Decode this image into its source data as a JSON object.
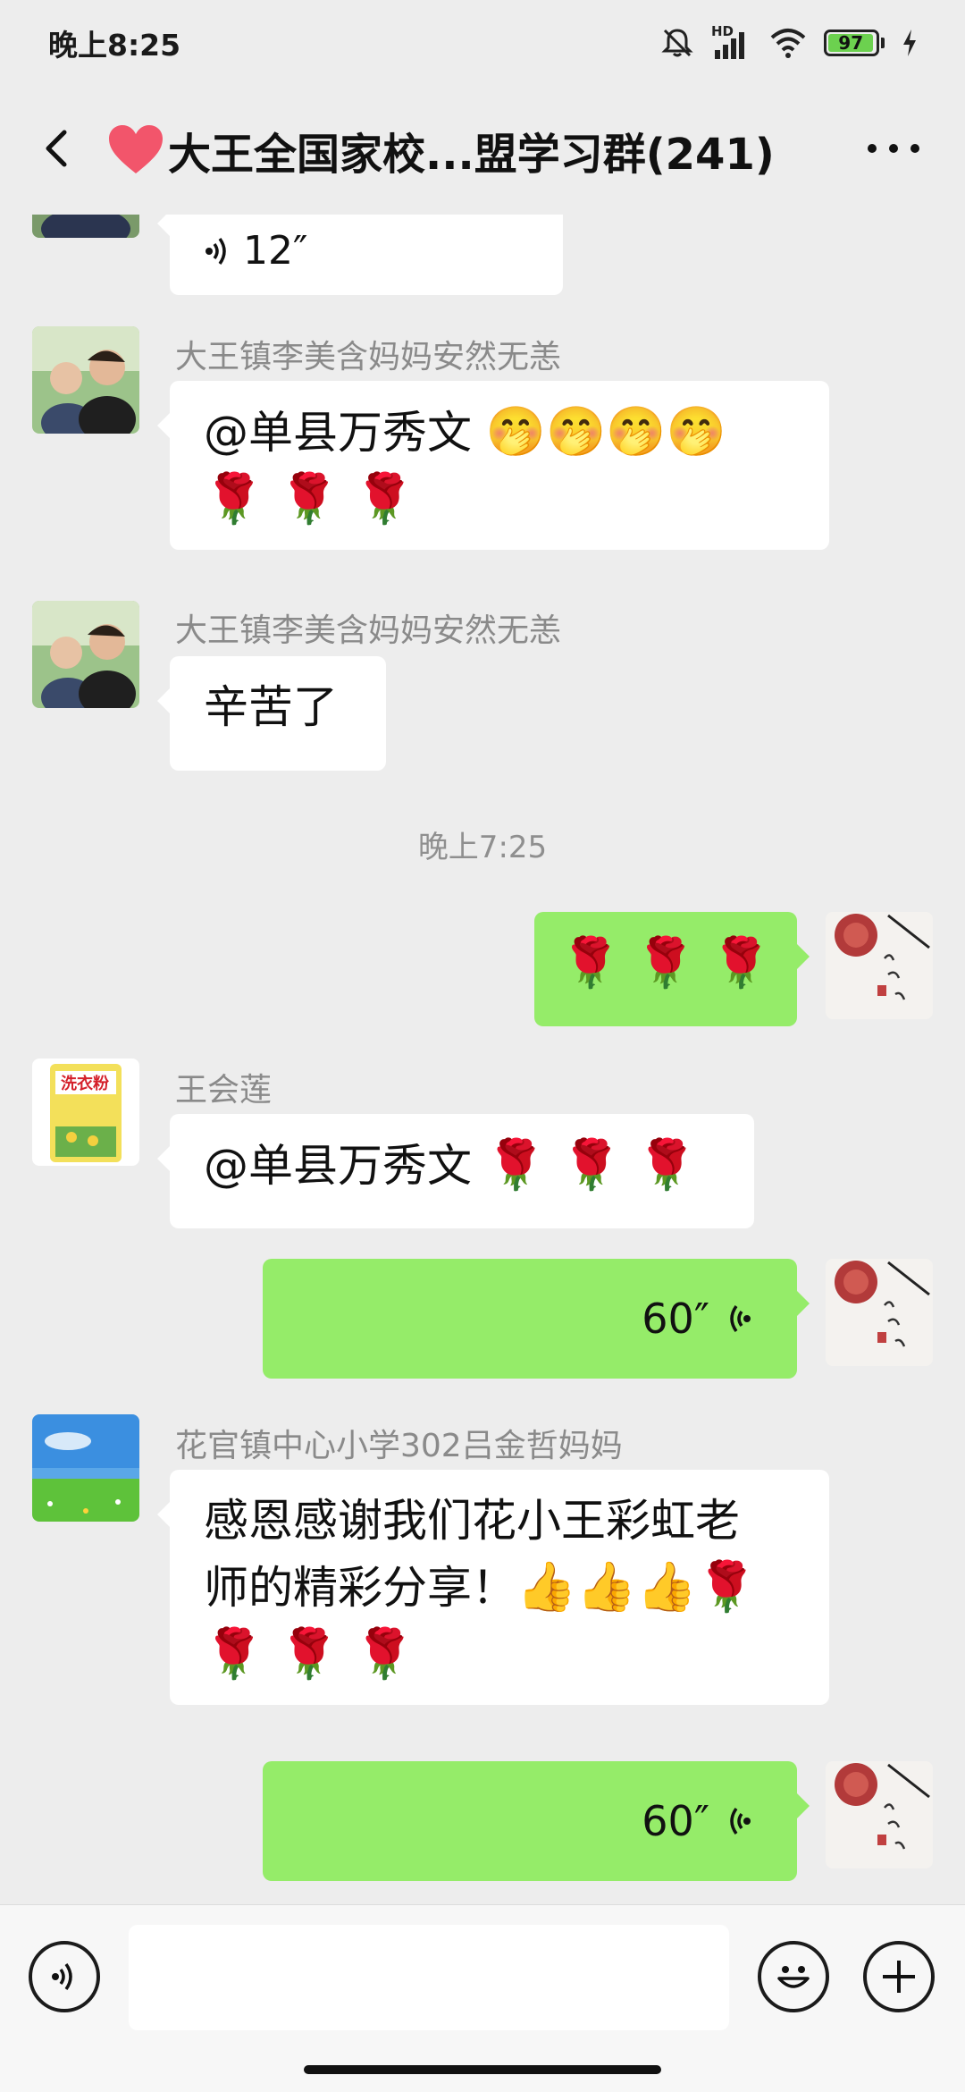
{
  "status_bar": {
    "time": "晚上8:25",
    "network": "HD",
    "battery_level": "97",
    "icons": [
      "mute-icon",
      "signal-icon",
      "wifi-icon",
      "battery-icon",
      "charging-icon"
    ]
  },
  "nav": {
    "title": "大王全国家校...盟学习群(241)",
    "title_icon": "heart-icon"
  },
  "messages": {
    "voice_top": {
      "duration": "12″"
    },
    "msg1": {
      "sender": "大王镇李美含妈妈安然无恙",
      "text": "@单县万秀文 ",
      "emoji_line1": "🤭🤭🤭🤭",
      "emoji_line2": "🌹 🌹 🌹"
    },
    "msg2": {
      "sender": "大王镇李美含妈妈安然无恙",
      "text": "辛苦了"
    },
    "timestamp": "晚上7:25",
    "msg3_self": {
      "emoji": "🌹 🌹 🌹"
    },
    "msg4": {
      "sender": "王会莲",
      "text": "@单县万秀文 ",
      "emoji": "🌹 🌹 🌹"
    },
    "msg5_self": {
      "duration": "60″"
    },
    "msg6": {
      "sender": "花官镇中心小学302吕金哲妈妈",
      "line1": "感恩感谢我们花小王彩虹老",
      "line2": "师的精彩分享！",
      "line2_emoji": "👍👍👍🌹",
      "line3_emoji": "🌹 🌹 🌹"
    },
    "msg7_self": {
      "duration": "60″"
    }
  },
  "input_bar": {
    "placeholder": ""
  },
  "colors": {
    "background": "#ededed",
    "self_bubble": "#95ec69",
    "other_bubble": "#ffffff",
    "battery_fill": "#6cd14f"
  }
}
